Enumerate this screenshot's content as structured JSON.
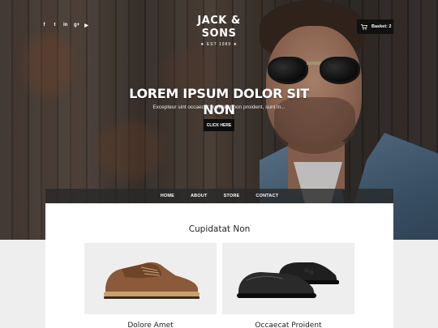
{
  "header": {
    "social_icons": [
      {
        "icon": "facebook-icon",
        "glyph": "f"
      },
      {
        "icon": "twitter-icon",
        "glyph": "t"
      },
      {
        "icon": "linkedin-icon",
        "glyph": "in"
      },
      {
        "icon": "google-plus-icon",
        "glyph": "g+"
      },
      {
        "icon": "youtube-icon",
        "glyph": "▶"
      }
    ],
    "logo": {
      "name": "JACK & SONS",
      "tagline": "★ EST 1989 ★"
    },
    "basket": {
      "icon": "cart-icon",
      "label": "Basket: 2"
    }
  },
  "hero": {
    "title": "LOREM IPSUM DOLOR SIT NON",
    "subtitle": "Excepteur sint occaecat cupidatat non proident, sunt in...",
    "cta_label": "CLICK HERE"
  },
  "nav": {
    "items": [
      "HOME",
      "ABOUT",
      "STORE",
      "CONTACT"
    ]
  },
  "section": {
    "title": "Cupidatat Non",
    "products": [
      {
        "name": "Dolore Amet",
        "image": "brown-suede-shoe"
      },
      {
        "name": "Occaecat Proident",
        "image": "black-leather-shoes"
      }
    ]
  },
  "colors": {
    "accent": "#0d0d0d",
    "nav_bg": "#282828",
    "page_bg": "#eeeeee"
  }
}
